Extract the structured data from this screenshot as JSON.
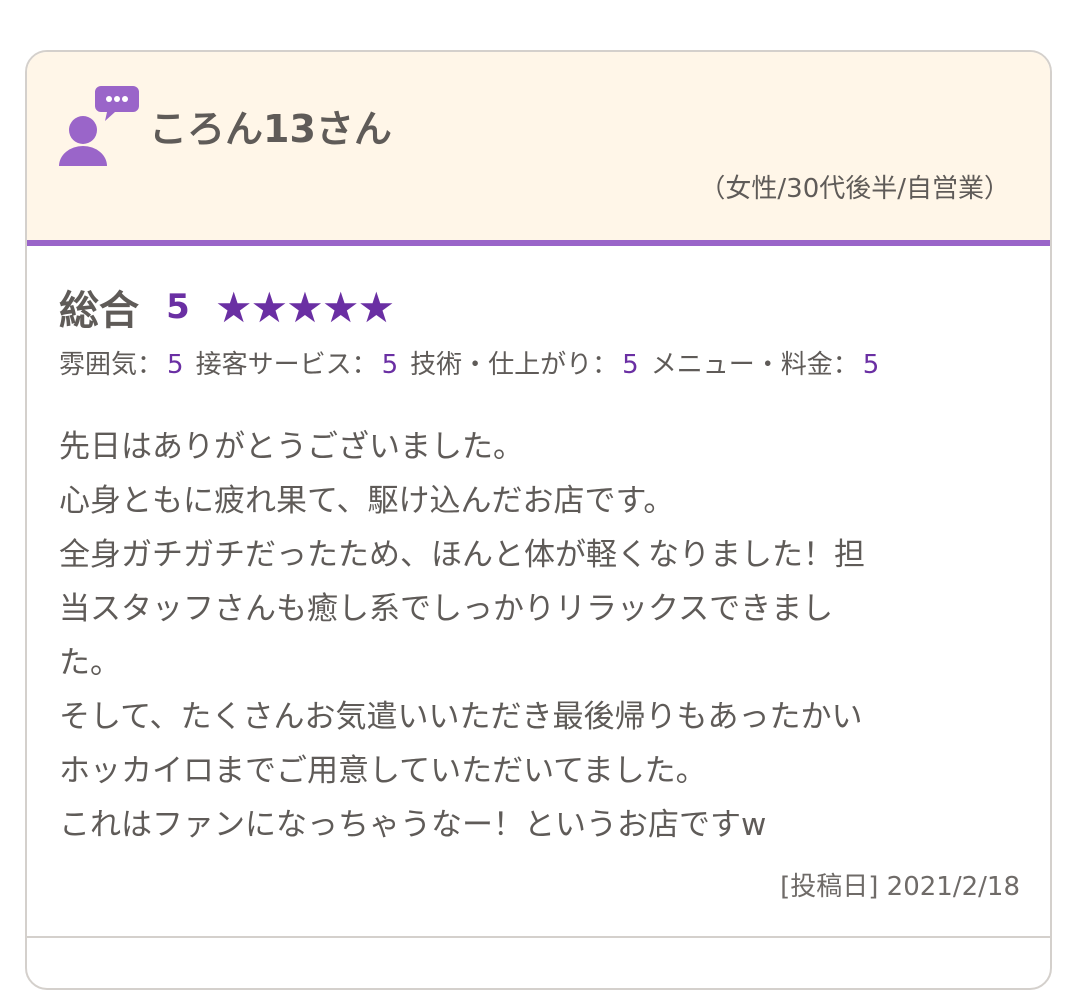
{
  "review": {
    "user_name": "ころん13さん",
    "profile": "（女性/30代後半/自営業）",
    "overall_label": "総合",
    "overall_score": "5",
    "star_rating": 5,
    "sub_ratings": [
      {
        "label": "雰囲気：",
        "value": "5"
      },
      {
        "label": "接客サービス：",
        "value": "5"
      },
      {
        "label": "技術・仕上がり：",
        "value": "5"
      },
      {
        "label": "メニュー・料金：",
        "value": "5"
      }
    ],
    "body_lines": [
      "先日はありがとうございました。",
      "心身ともに疲れ果て、駆け込んだお店です。",
      "全身ガチガチだったため、ほんと体が軽くなりました！担",
      "当スタッフさんも癒し系でしっかりリラックスできまし",
      "た。",
      "そして、たくさんお気遣いいただき最後帰りもあったかい",
      "ホッカイロまでご用意していただいてました。",
      "これはファンになっちゃうなー！というお店ですw"
    ],
    "posted_label": "[投稿日]",
    "posted_date": "2021/2/18"
  },
  "colors": {
    "accent": "#9a65c9",
    "score": "#6a2fa3",
    "header_bg": "#fff6e8",
    "text": "#5f5b58"
  },
  "icons": {
    "avatar": "user-speech-bubble-icon",
    "star": "star-icon"
  }
}
